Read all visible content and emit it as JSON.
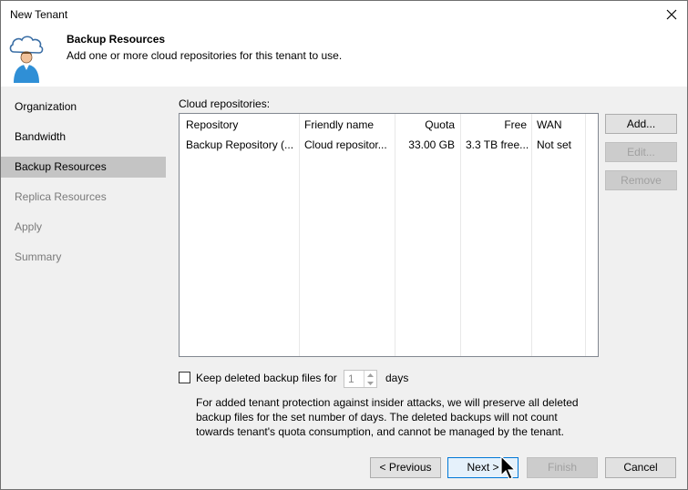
{
  "window": {
    "title": "New Tenant",
    "close_icon": "close-icon"
  },
  "header": {
    "title": "Backup Resources",
    "subtitle": "Add one or more cloud repositories for this tenant to use.",
    "icon": "cloud-user-icon"
  },
  "nav": {
    "items": [
      {
        "label": "Organization",
        "state": "normal"
      },
      {
        "label": "Bandwidth",
        "state": "normal"
      },
      {
        "label": "Backup Resources",
        "state": "active"
      },
      {
        "label": "Replica Resources",
        "state": "disabled"
      },
      {
        "label": "Apply",
        "state": "disabled"
      },
      {
        "label": "Summary",
        "state": "disabled"
      }
    ]
  },
  "content": {
    "repos_label": "Cloud repositories:",
    "columns": [
      "Repository",
      "Friendly name",
      "Quota",
      "Free",
      "WAN"
    ],
    "rows": [
      {
        "repository": "Backup Repository (...",
        "friendly_name": "Cloud repositor...",
        "quota": "33.00 GB",
        "free": "3.3 TB free...",
        "wan": "Not set"
      }
    ],
    "buttons": {
      "add": "Add...",
      "edit": "Edit...",
      "remove": "Remove"
    },
    "keep_deleted": {
      "label": "Keep deleted backup files for",
      "value": "1",
      "unit": "days",
      "checked": false
    },
    "note": "For added tenant protection against insider attacks, we will preserve all deleted backup files for the set number of days. The deleted backups will not count towards tenant's quota consumption, and cannot be managed by the tenant."
  },
  "footer": {
    "previous": "< Previous",
    "next": "Next >",
    "finish": "Finish",
    "cancel": "Cancel"
  },
  "colors": {
    "active_nav": "#c4c4c4",
    "panel_bg": "#f0f0f0",
    "primary_border": "#0078d7"
  }
}
